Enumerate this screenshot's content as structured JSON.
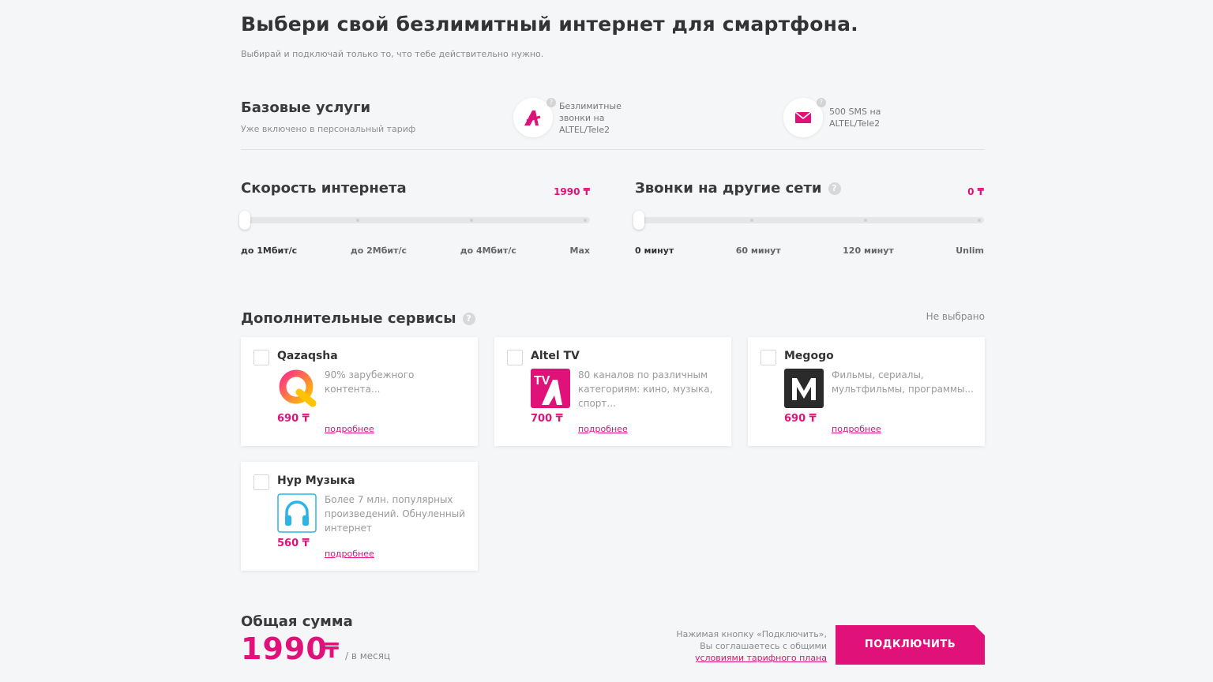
{
  "header": {
    "title": "Выбери свой безлимитный интернет для смартфона.",
    "subtitle": "Выбирай и подключай только то, что тебе действительно нужно."
  },
  "base": {
    "title": "Базовые услуги",
    "subtitle": "Уже включено в персональный тариф",
    "items": [
      {
        "icon": "altel-logo-icon",
        "text": "Безлимитные звонки на ALTEL/Tele2"
      },
      {
        "icon": "envelope-icon",
        "text": "500 SMS на ALTEL/Tele2"
      }
    ]
  },
  "speed": {
    "title": "Скорость интернета",
    "price": "1990 ₸",
    "stops": [
      "до 1Мбит/с",
      "до 2Мбит/с",
      "до 4Мбит/с",
      "Max"
    ],
    "selected_index": 0
  },
  "calls": {
    "title": "Звонки на другие сети",
    "price": "0 ₸",
    "stops": [
      "0 минут",
      "60 минут",
      "120 минут",
      "Unlim"
    ],
    "selected_index": 0
  },
  "extras": {
    "title": "Дополнительные сервисы",
    "status": "Не выбрано",
    "more_label": "подробнее",
    "cards": [
      {
        "name": "Qazaqsha",
        "desc": "90% зарубежного контента...",
        "price": "690 ₸",
        "icon": "qazaqsha-logo-icon"
      },
      {
        "name": "Altel TV",
        "desc": "80 каналов по различным категориям: кино, музыка, спорт...",
        "price": "700 ₸",
        "icon": "altel-tv-logo-icon"
      },
      {
        "name": "Megogo",
        "desc": "Фильмы, сериалы, мультфильмы, программы...",
        "price": "690 ₸",
        "icon": "megogo-logo-icon"
      },
      {
        "name": "Нур Музыка",
        "desc": "Более 7 млн. популярных произведений. Обнуленный интернет",
        "price": "560 ₸",
        "icon": "headphones-icon"
      }
    ]
  },
  "total": {
    "label": "Общая сумма",
    "amount": "1990",
    "currency": "₸",
    "period": "/ в месяц"
  },
  "footer": {
    "terms_text": "Нажимая кнопку «Подключить», Вы соглашаетесь с общими",
    "terms_link": "условиями тарифного плана",
    "connect_label": "ПОДКЛЮЧИТЬ"
  },
  "colors": {
    "accent": "#e0127a",
    "background": "#f5f6f7"
  }
}
